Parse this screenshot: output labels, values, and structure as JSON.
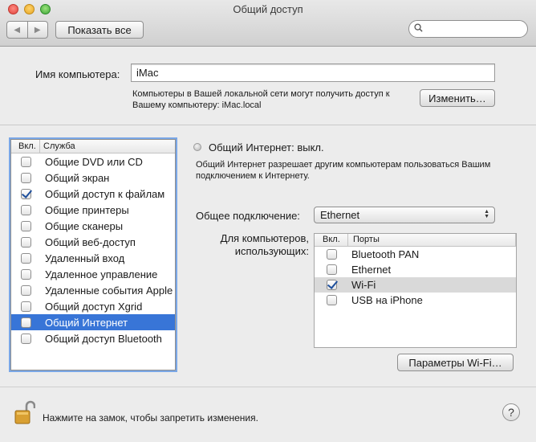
{
  "window": {
    "title": "Общий доступ"
  },
  "toolbar": {
    "back_icon": "◀",
    "forward_icon": "▶",
    "show_all_label": "Показать все",
    "search_placeholder": ""
  },
  "computer_name": {
    "label": "Имя компьютера:",
    "value": "iMac",
    "info_line1": "Компьютеры в Вашей локальной сети могут получить доступ к",
    "info_line2": "Вашему компьютеру: iMac.local",
    "edit_label": "Изменить…"
  },
  "services": {
    "header_on": "Вкл.",
    "header_service": "Служба",
    "items": [
      {
        "label": "Общие DVD или CD",
        "checked": false,
        "selected": false
      },
      {
        "label": "Общий экран",
        "checked": false,
        "selected": false
      },
      {
        "label": "Общий доступ к файлам",
        "checked": true,
        "selected": false
      },
      {
        "label": "Общие принтеры",
        "checked": false,
        "selected": false
      },
      {
        "label": "Общие сканеры",
        "checked": false,
        "selected": false
      },
      {
        "label": "Общий веб-доступ",
        "checked": false,
        "selected": false
      },
      {
        "label": "Удаленный вход",
        "checked": false,
        "selected": false
      },
      {
        "label": "Удаленное управление",
        "checked": false,
        "selected": false
      },
      {
        "label": "Удаленные события Apple",
        "checked": false,
        "selected": false
      },
      {
        "label": "Общий доступ Xgrid",
        "checked": false,
        "selected": false
      },
      {
        "label": "Общий Интернет",
        "checked": false,
        "selected": true
      },
      {
        "label": "Общий доступ Bluetooth",
        "checked": false,
        "selected": false
      }
    ]
  },
  "internet_sharing": {
    "status": "Общий Интернет: выкл.",
    "desc_line1": "Общий Интернет разрешает другим компьютерам пользоваться Вашим",
    "desc_line2": "подключением к Интернету.",
    "connection_label": "Общее подключение:",
    "connection_value": "Ethernet",
    "computers_label_line1": "Для компьютеров,",
    "computers_label_line2": "использующих:",
    "ports_header_on": "Вкл.",
    "ports_header_ports": "Порты",
    "ports": [
      {
        "label": "Bluetooth PAN",
        "checked": false,
        "highlight": false
      },
      {
        "label": "Ethernet",
        "checked": false,
        "highlight": false
      },
      {
        "label": "Wi-Fi",
        "checked": true,
        "highlight": true
      },
      {
        "label": "USB на iPhone",
        "checked": false,
        "highlight": false
      }
    ],
    "wifi_button_label": "Параметры Wi-Fi…"
  },
  "footer": {
    "lock_text": "Нажмите на замок, чтобы запретить изменения.",
    "help_label": "?"
  }
}
